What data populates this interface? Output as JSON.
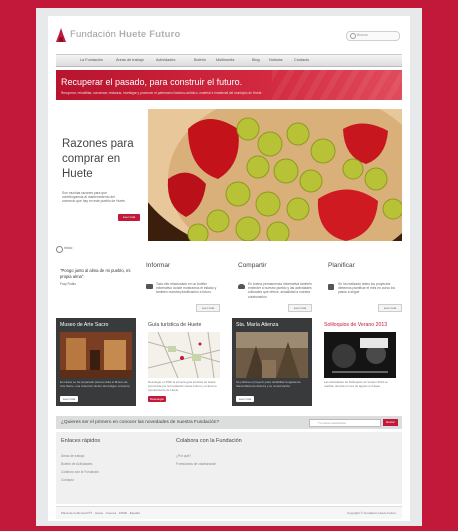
{
  "header": {
    "brand_light": "Fundación",
    "brand_bold": "Huete Futuro",
    "search_placeholder": "Buscar"
  },
  "nav": {
    "items": [
      "",
      "La Fundación",
      "Áreas de trabajo",
      "Actividades",
      "Boletín",
      "Multimedia",
      "Blog",
      "Noticias",
      "Contacto"
    ]
  },
  "hero": {
    "title": "Recuperar el pasado, para construir el futuro.",
    "subtitle": "Recuperar, rehabilitar, conservar, restaurar, investigar y promover el patrimonio histórico-artístico, material e inmaterial del municipio de Huete."
  },
  "feature": {
    "title": "Razones para comprar en Huete",
    "description": "Son muchas razones para que contribuyamos al mantenimiento del comercio que hay en este pueblo de Huete.",
    "button": "Leer más"
  },
  "breadcrumb": "Inicio",
  "quote": {
    "text": "\"Pongo junto al alma de mi pueblo, mi propia alma\".",
    "author": "Fray Rubio"
  },
  "columns": [
    {
      "title": "Informar",
      "text": "Todo ello relacionado en un boletín informativo donde mostramos el estado y también nuestra planificación a futuro.",
      "more": "Leer más"
    },
    {
      "title": "Compartir",
      "text": "En buena permanencia informativa también entender a nuestro pueblo y las actividades culturales que ofrece, actualidad a nuestra colaboración",
      "more": "Leer más"
    },
    {
      "title": "Planificar",
      "text": "Se ha realizado antes los proyectos debemos planificar el mes en curso los pasos a seguir",
      "more": "Leer más"
    }
  ],
  "cards": [
    {
      "title": "Museo de Arte Sacro",
      "text": "En Huete se ha preparado para la visita el Museo de Arte Sacro, una colección dentro del antiguo convento.",
      "button": "Leer más"
    },
    {
      "title": "Guía turística de Huete",
      "text": "Descargar en PDF la primera guía turística de Huete promovida por la Fundación Huete Futuro y el Excmo. Ayuntamiento de Huete.",
      "button": "Descargar"
    },
    {
      "title": "Sta. María Atienza",
      "text": "Se publica el proyecto para rehabilitar la iglesia de Santa María de Atienza y su conservación.",
      "button": "Leer más"
    },
    {
      "title": "Soliloquios de Verano 2013",
      "text": "Las actividades de Soliloquios de Verano 2013 se realizan durante el mes de agosto en Huete.",
      "button": "Leer más"
    }
  ],
  "newsletter": {
    "question": "¿Quieres ser el primero en conocer las novedades de nuestra Fundación?",
    "input_placeholder": "Tu correo electrónico",
    "button": "Enviar"
  },
  "footer": {
    "links_title": "Enlaces rápidos",
    "links": [
      "Áreas de trabajo",
      "Boletín de Actividades",
      "Colabora con la Fundación",
      "Contacto"
    ],
    "collab_title": "Colabora con la Fundación",
    "collab_links": [
      "¿Por qué?",
      "Formularios de colaboración"
    ],
    "address": "Plaza de la Merced Nº7 · Huete · Cuenca · 16500 · España",
    "copyright": "Copyright © Fundación Huete Futuro"
  },
  "colors": {
    "brand": "#c2183a",
    "page_bg": "#ffffff",
    "dark_card": "#383a3c"
  }
}
